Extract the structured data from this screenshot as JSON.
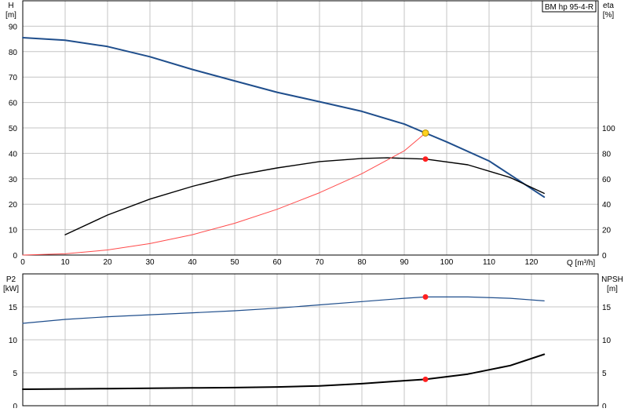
{
  "colors": {
    "head_curve": "#1f4e8c",
    "eta_curve": "#000000",
    "system_curve": "#ff4a4a",
    "p2_curve": "#1f4e8c",
    "npsh_curve": "#000000",
    "duty_point": "#ffd21f",
    "operating_marker": "#ff2020",
    "grid": "#c4c4c4"
  },
  "chart_data": [
    {
      "type": "line",
      "id": "upper",
      "label_box": "BM hp 95-4-R",
      "xlabel": "Q [m³/h]",
      "xlim": [
        0,
        128
      ],
      "xticks": [
        0,
        10,
        20,
        30,
        40,
        50,
        60,
        70,
        80,
        90,
        100,
        110,
        120
      ],
      "ylabel_left": {
        "name": "H",
        "unit": "[m]"
      },
      "ylabel_right": {
        "name": "eta",
        "unit": "[%]"
      },
      "ylim_left": [
        0,
        100
      ],
      "yticks_left": [
        0,
        10,
        20,
        30,
        40,
        50,
        60,
        70,
        80,
        90
      ],
      "ylim_right": [
        0,
        200
      ],
      "yticks_right": [
        0,
        20,
        40,
        60,
        80,
        100
      ],
      "grid": true,
      "series": [
        {
          "key": "head",
          "axis": "left",
          "color_key": "head_curve",
          "width": 2,
          "x": [
            0,
            10,
            20,
            30,
            40,
            50,
            60,
            70,
            80,
            90,
            95,
            100,
            110,
            123
          ],
          "y": [
            85.5,
            84.5,
            82,
            78,
            73,
            68.5,
            64,
            60.3,
            56.5,
            51.5,
            48,
            44.5,
            37,
            22.8
          ]
        },
        {
          "key": "eta",
          "axis": "right",
          "color_key": "eta_curve",
          "width": 1.4,
          "x": [
            10,
            20,
            30,
            40,
            50,
            60,
            70,
            80,
            86,
            95,
            105,
            115,
            123
          ],
          "y": [
            16,
            31.5,
            44,
            54,
            62.5,
            68.5,
            73.5,
            76,
            76.5,
            75.5,
            71,
            61,
            48.5
          ]
        },
        {
          "key": "system",
          "axis": "left",
          "color_key": "system_curve",
          "width": 1,
          "x": [
            0,
            10,
            20,
            30,
            40,
            50,
            60,
            70,
            80,
            90,
            95
          ],
          "y": [
            0,
            0.5,
            2,
            4.5,
            8,
            12.5,
            18,
            24.5,
            32,
            41,
            48
          ]
        }
      ],
      "markers": [
        {
          "axis": "left",
          "x": 95,
          "y": 48,
          "color_key": "duty_point",
          "stroke": "#b08a00",
          "r": 4
        },
        {
          "axis": "right",
          "x": 95,
          "y": 75.5,
          "color_key": "operating_marker",
          "stroke": "#ff2020",
          "r": 3
        }
      ]
    },
    {
      "type": "line",
      "id": "lower",
      "xlim": [
        0,
        128
      ],
      "xticks": [
        0,
        10,
        20,
        30,
        40,
        50,
        60,
        70,
        80,
        90,
        100,
        110,
        120
      ],
      "ylabel_left": {
        "name": "P2",
        "unit": "[kW]"
      },
      "ylabel_right": {
        "name": "NPSH",
        "unit": "[m]"
      },
      "ylim_left": [
        0,
        20
      ],
      "yticks_left": [
        0,
        5,
        10,
        15
      ],
      "ylim_right": [
        0,
        20
      ],
      "yticks_right": [
        0,
        5,
        10,
        15
      ],
      "grid": true,
      "series": [
        {
          "key": "p2",
          "axis": "left",
          "color_key": "p2_curve",
          "width": 1.2,
          "x": [
            0,
            10,
            20,
            30,
            40,
            50,
            60,
            70,
            80,
            90,
            95,
            105,
            115,
            123
          ],
          "y": [
            12.5,
            13.1,
            13.5,
            13.8,
            14.1,
            14.4,
            14.8,
            15.3,
            15.8,
            16.3,
            16.5,
            16.5,
            16.3,
            15.9
          ]
        },
        {
          "key": "npsh",
          "axis": "right",
          "color_key": "npsh_curve",
          "width": 2,
          "x": [
            0,
            10,
            20,
            30,
            40,
            50,
            60,
            70,
            80,
            90,
            95,
            105,
            115,
            123
          ],
          "y": [
            2.5,
            2.55,
            2.6,
            2.65,
            2.7,
            2.75,
            2.85,
            3.0,
            3.35,
            3.8,
            4.0,
            4.8,
            6.1,
            7.8
          ]
        }
      ],
      "markers": [
        {
          "axis": "left",
          "x": 95,
          "y": 16.5,
          "color_key": "operating_marker",
          "stroke": "#ff2020",
          "r": 3
        },
        {
          "axis": "right",
          "x": 95,
          "y": 4.0,
          "color_key": "operating_marker",
          "stroke": "#ff2020",
          "r": 3
        }
      ]
    }
  ]
}
